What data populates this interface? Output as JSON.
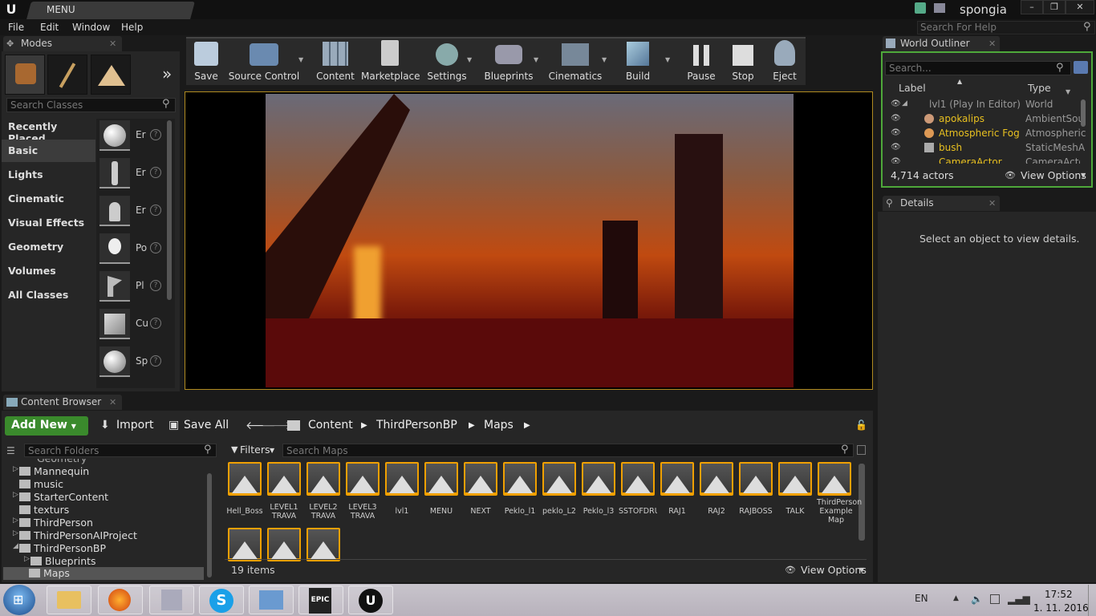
{
  "window": {
    "tab_title": "MENU",
    "user": "spongia",
    "help_search_placeholder": "Search For Help"
  },
  "menu": [
    "File",
    "Edit",
    "Window",
    "Help"
  ],
  "modes": {
    "tab_title": "Modes",
    "search_placeholder": "Search Classes",
    "categories": [
      "Recently Placed",
      "Basic",
      "Lights",
      "Cinematic",
      "Visual Effects",
      "Geometry",
      "Volumes",
      "All Classes"
    ],
    "selected_category": "Basic",
    "items": [
      "Er",
      "Er",
      "Er",
      "Po",
      "Pl",
      "Cu",
      "Sp"
    ]
  },
  "toolbar": [
    "Save",
    "Source Control",
    "Content",
    "Marketplace",
    "Settings",
    "Blueprints",
    "Cinematics",
    "Build",
    "Pause",
    "Stop",
    "Eject"
  ],
  "outliner": {
    "tab_title": "World Outliner",
    "search_placeholder": "Search...",
    "col_label": "Label",
    "col_type": "Type",
    "rows": [
      {
        "label": "lvl1 (Play In Editor)",
        "type": "World"
      },
      {
        "label": "apokalips",
        "type": "AmbientSou"
      },
      {
        "label": "Atmospheric Fog",
        "type": "Atmospheric"
      },
      {
        "label": "bush",
        "type": "StaticMeshA"
      },
      {
        "label": "CameraActor",
        "type": "CameraActo"
      }
    ],
    "actor_count": "4,714 actors",
    "view_options": "View Options"
  },
  "details": {
    "tab_title": "Details",
    "empty_message": "Select an object to view details."
  },
  "content_browser": {
    "tab_title": "Content Browser",
    "add_new": "Add New",
    "import": "Import",
    "save_all": "Save All",
    "breadcrumb": [
      "Content",
      "ThirdPersonBP",
      "Maps"
    ],
    "folder_search_placeholder": "Search Folders",
    "folders": [
      "Geometry",
      "Mannequin",
      "music",
      "StarterContent",
      "texturs",
      "ThirdPerson",
      "ThirdPersonAIProject",
      "ThirdPersonBP",
      "Blueprints",
      "Maps"
    ],
    "filters": "Filters",
    "search_placeholder": "Search Maps",
    "assets": [
      "Hell_Boss",
      "LEVEL1 TRAVA",
      "LEVEL2 TRAVA",
      "LEVEL3 TRAVA",
      "lvl1",
      "MENU",
      "NEXT",
      "Peklo_l1",
      "peklo_L2",
      "Peklo_l3",
      "SSTOFDRUH",
      "RAJ1",
      "RAJ2",
      "RAJBOSS",
      "TALK",
      "ThirdPerson Example Map",
      "",
      "",
      ""
    ],
    "item_count": "19 items",
    "view_options": "View Options"
  },
  "taskbar": {
    "lang": "EN",
    "time": "17:52",
    "date": "1. 11. 2016",
    "apps": [
      "Start",
      "Explorer",
      "Firefox",
      "Files",
      "Skype",
      "Control",
      "Epic Games",
      "Unreal Engine"
    ]
  }
}
